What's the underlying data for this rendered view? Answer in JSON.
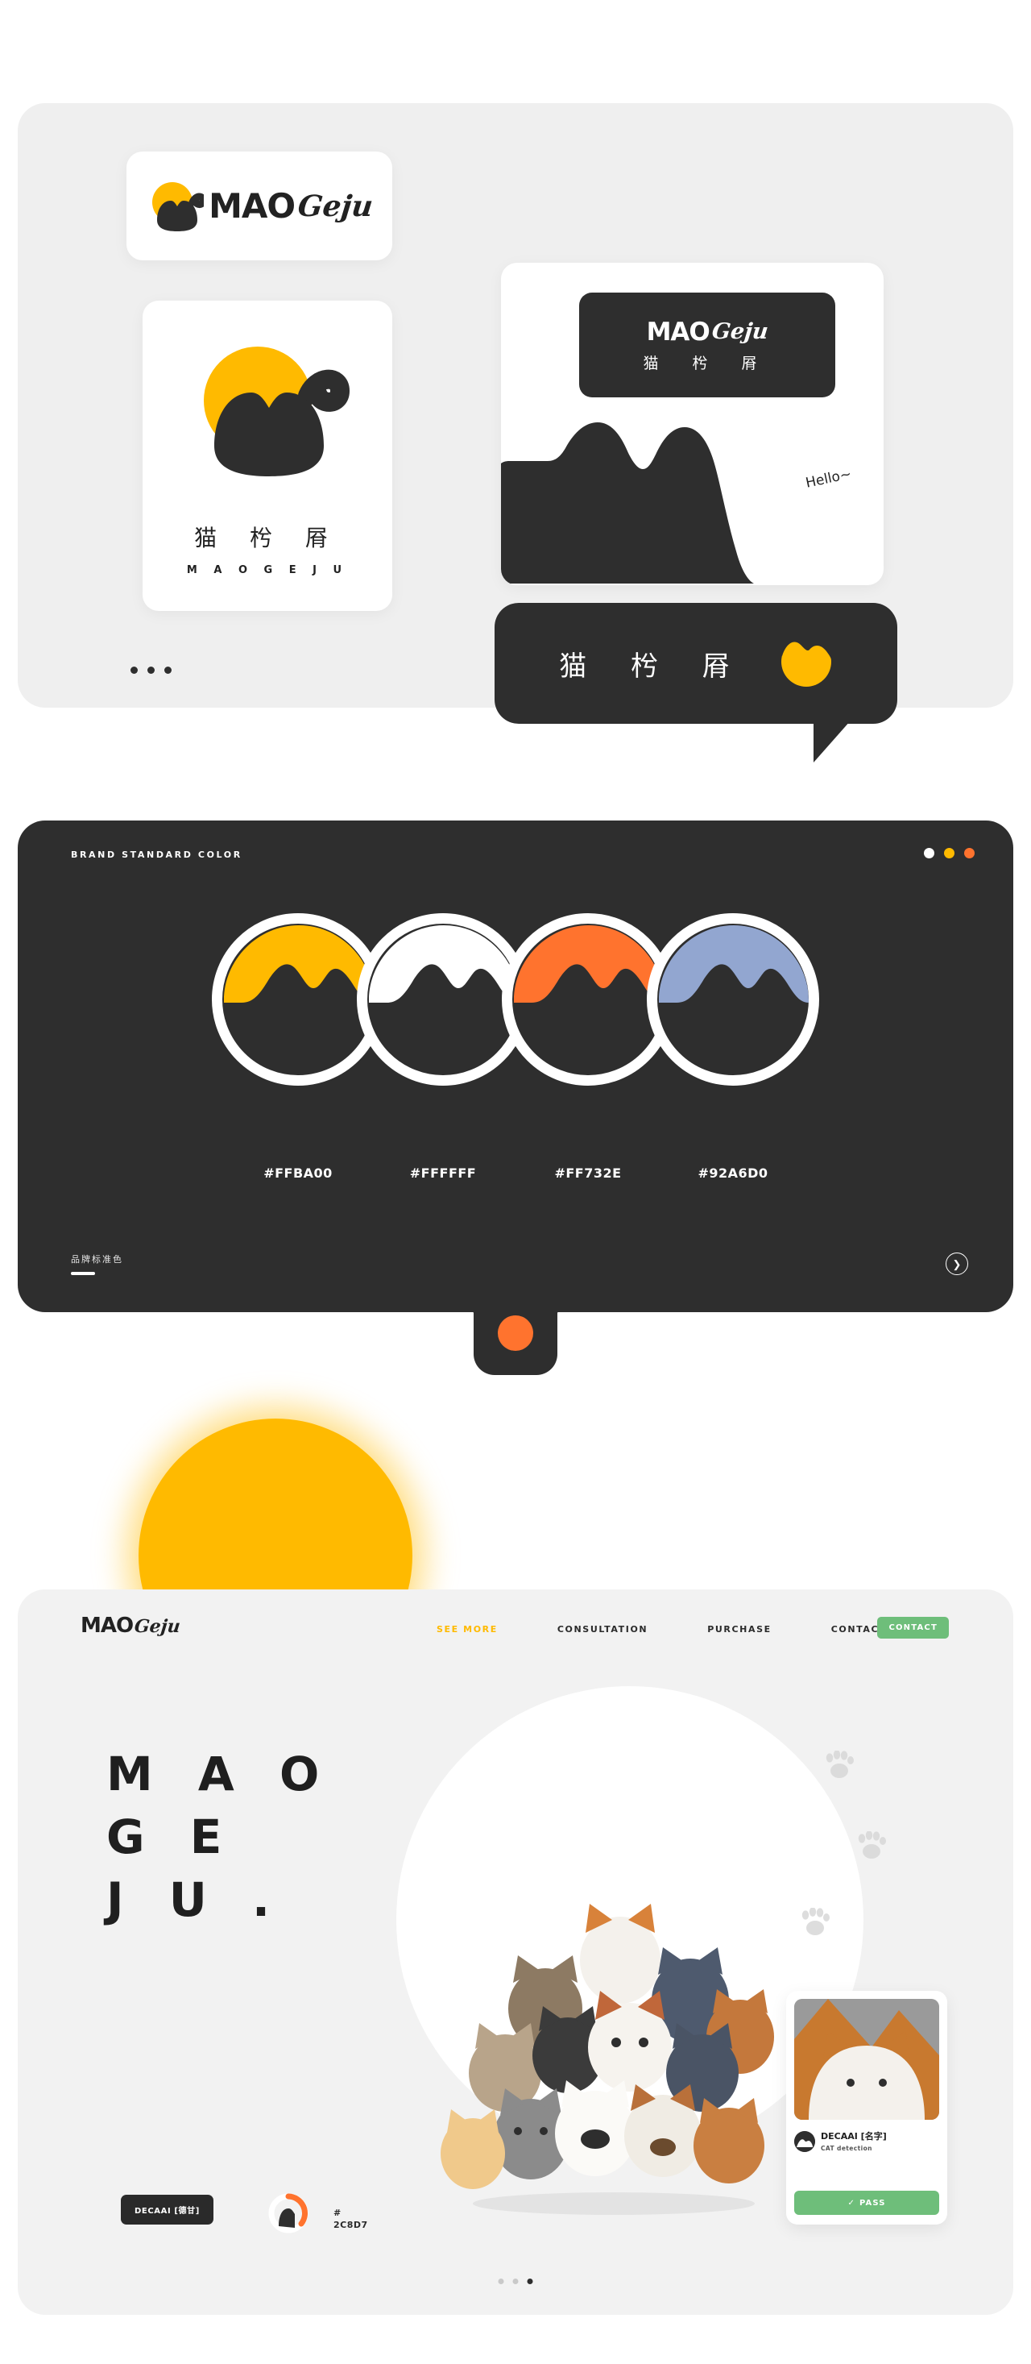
{
  "brand": {
    "wordmark": "MAO",
    "script": "Geju",
    "cn_name": "猫 枍 㞕",
    "latin_spaced": "M A O G E J U",
    "greeting": "Hello~",
    "accent": "#FFBA00",
    "dark": "#2E2E2E"
  },
  "panel_logos": {
    "name": "logo-showcase",
    "cards": {
      "horizontal": {
        "wordmark": "MAO",
        "script": "Geju"
      },
      "square": {
        "cn_name": "猫 枍 㞕",
        "latin": "M A O G E J U"
      },
      "scene": {
        "wordmark": "MAO",
        "script": "Geju",
        "cn_name": "猫 枍 㞕",
        "note": "Hello~"
      },
      "bubble": {
        "cn_name": "猫 枍 㞕"
      }
    },
    "pager_dots": 3
  },
  "panel_colors": {
    "title": "BRAND STANDARD COLOR",
    "title_cn": "品牌标准色",
    "next_icon": "chevron-right-icon",
    "window_dots": [
      "#ffffff",
      "#FFBA00",
      "#FF732E"
    ],
    "swatches": [
      {
        "hex": "#FFBA00",
        "label": "#FFBA00"
      },
      {
        "hex": "#FFFFFF",
        "label": "#FFFFFF"
      },
      {
        "hex": "#FF732E",
        "label": "#FF732E"
      },
      {
        "hex": "#92A6D0",
        "label": "#92A6D0"
      }
    ],
    "tab_dot_color": "#FF732E"
  },
  "panel_web": {
    "logo": {
      "wordmark": "MAO",
      "script": "Geju"
    },
    "nav": [
      {
        "label": "SEE MORE",
        "active": true
      },
      {
        "label": "CONSULTATION",
        "active": false
      },
      {
        "label": "PURCHASE",
        "active": false
      },
      {
        "label": "CONTACT",
        "active": false
      }
    ],
    "cta": {
      "label": "CONTACT",
      "color": "#6EBE7A"
    },
    "headline": "MAO\nGEJU.",
    "headline_lines": [
      "M A O",
      "G E",
      "J U ."
    ],
    "product_card": {
      "title": "DECAAI [名字]",
      "subtitle": "CAT detection",
      "button": "PASS",
      "button_icon": "check-circle-icon"
    },
    "pill_label": "DECAAI [德甘]",
    "hex_note": "#\n2C8D7",
    "hex_note_line1": "#",
    "hex_note_line2": "2C8D7",
    "carousel": {
      "count": 3,
      "active_index": 2
    }
  }
}
